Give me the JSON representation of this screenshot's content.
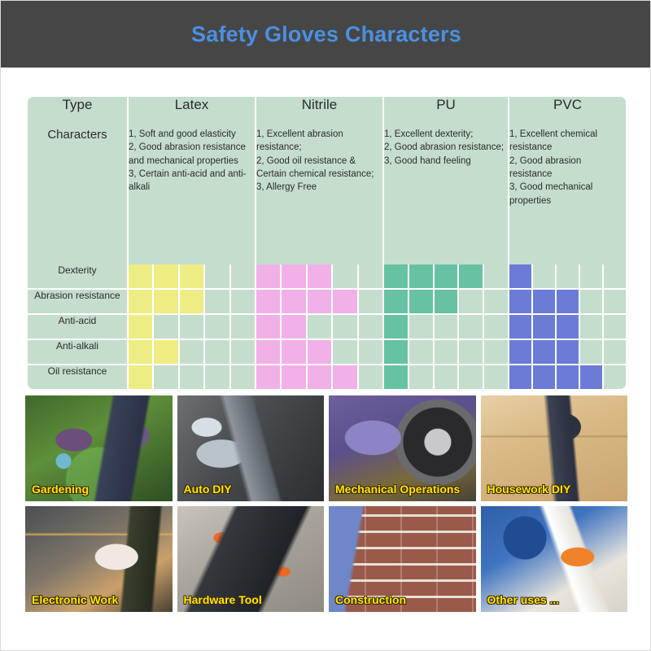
{
  "banner": {
    "title": "Safety Gloves Characters",
    "background_color": "#464646",
    "title_color": "#4a90e2"
  },
  "table": {
    "columns": [
      "Type",
      "Latex",
      "Nitrile",
      "PU",
      "PVC"
    ],
    "characters_row_label": "Characters",
    "characters": {
      "latex": "1, Soft and good elasticity\n2, Good abrasion resistance and mechanical properties\n3, Certain anti-acid and anti-alkali",
      "nitrile": "1, Excellent abrasion resistance;\n2, Good oil resistance & Certain chemical resistance;\n3, Allergy Free",
      "pu": "1, Excellent dexterity;\n2, Good abrasion resistance;\n3, Good hand feeling",
      "pvc": "1, Excellent chemical resistance\n2, Good abrasion resistance\n3, Good mechanical properties"
    },
    "cell_background": "#c5ddcd",
    "grid_line_color": "#ffffff"
  },
  "chart_data": {
    "type": "heatmap",
    "title": "Safety Gloves Characters",
    "xlabel": "",
    "ylabel": "",
    "cells_per_column": 5,
    "scale_max": 5,
    "categories": [
      "Latex",
      "Nitrile",
      "PU",
      "PVC"
    ],
    "rows": [
      "Dexterity",
      "Abrasion resistance",
      "Anti-acid",
      "Anti-alkali",
      "Oil resistance"
    ],
    "column_colors": {
      "Latex": "#eded84",
      "Nitrile": "#f2b0e8",
      "PU": "#66c2a3",
      "PVC": "#6b7bd6"
    },
    "empty_cell_color": "#c5ddcd",
    "series": [
      {
        "name": "Latex",
        "values": [
          3,
          3,
          1,
          2,
          1
        ]
      },
      {
        "name": "Nitrile",
        "values": [
          3,
          4,
          2,
          3,
          4
        ]
      },
      {
        "name": "PU",
        "values": [
          4,
          3,
          1,
          1,
          1
        ]
      },
      {
        "name": "PVC",
        "values": [
          1,
          3,
          3,
          3,
          4
        ]
      }
    ]
  },
  "gallery": {
    "rows": [
      [
        {
          "caption": "Gardening",
          "photo": "ph-gardening"
        },
        {
          "caption": "Auto DIY",
          "photo": "ph-auto"
        },
        {
          "caption": "Mechanical Operations",
          "photo": "ph-mech"
        },
        {
          "caption": "Housework DIY",
          "photo": "ph-house"
        }
      ],
      [
        {
          "caption": "Electronic Work",
          "photo": "ph-elec"
        },
        {
          "caption": "Hardware Tool",
          "photo": "ph-hard"
        },
        {
          "caption": "Construction",
          "photo": "ph-constr"
        },
        {
          "caption": "Other uses ...",
          "photo": "ph-other"
        }
      ]
    ],
    "caption_color": "#ffe600"
  }
}
